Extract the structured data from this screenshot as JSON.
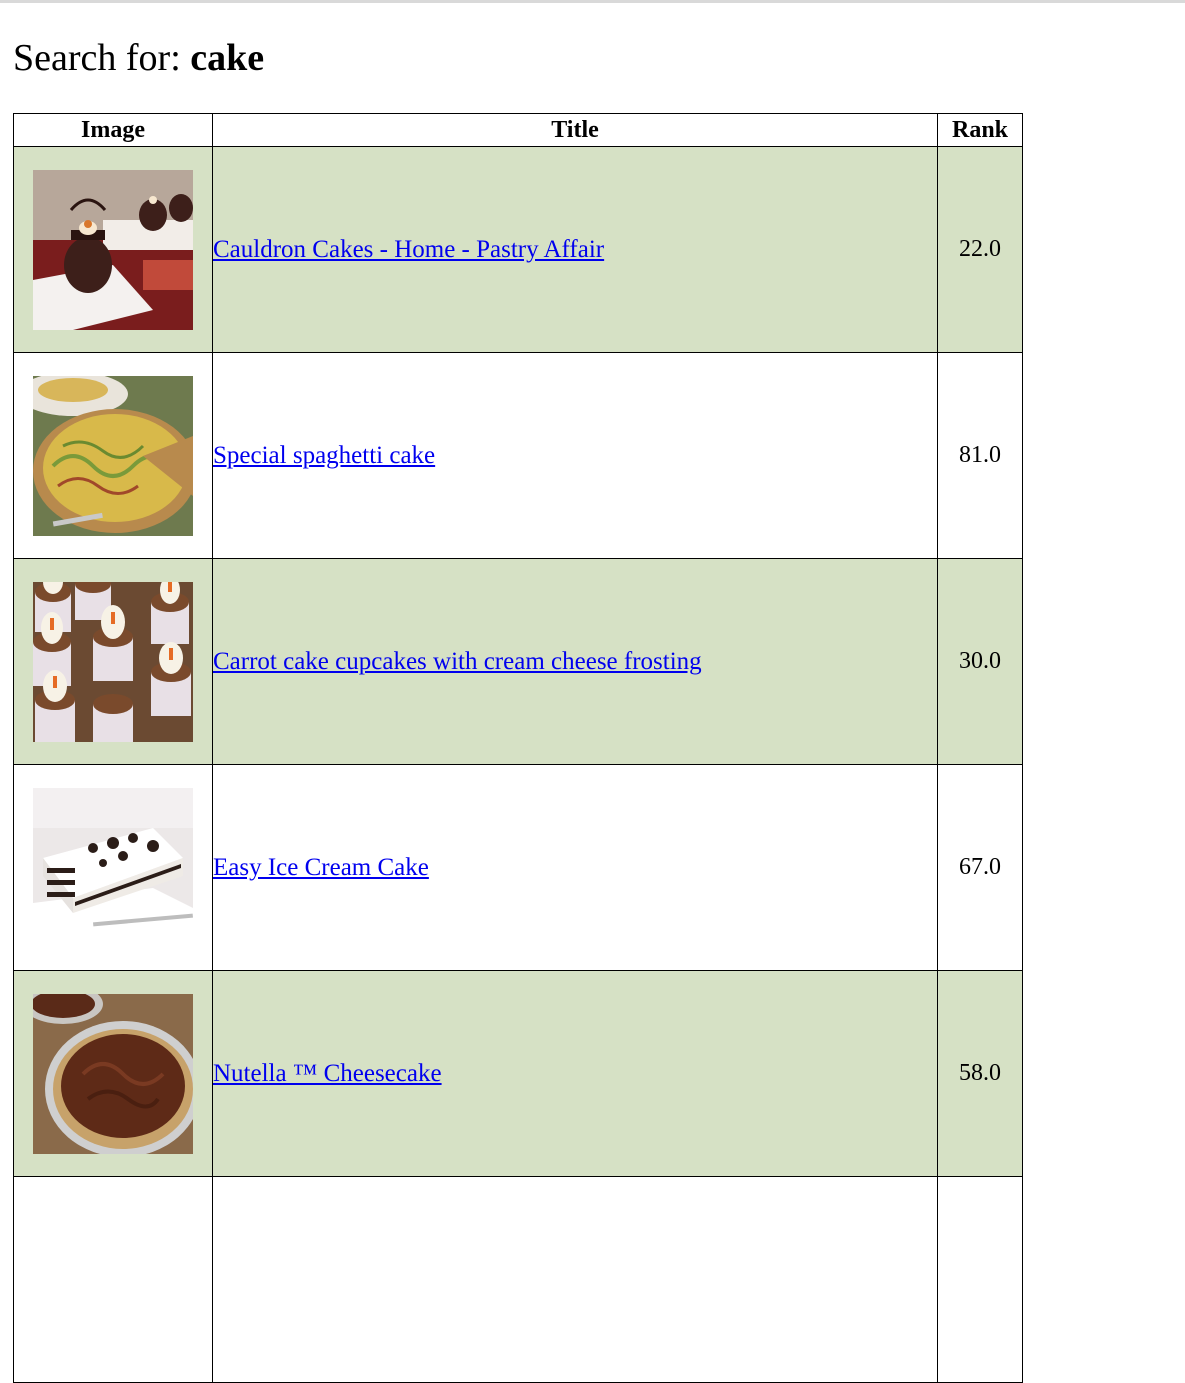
{
  "search": {
    "prefix": "Search for:",
    "query": "cake"
  },
  "table": {
    "headers": [
      "Image",
      "Title",
      "Rank"
    ],
    "rows": [
      {
        "title": "Cauldron Cakes - Home - Pastry Affair",
        "rank": "22.0",
        "image": "cauldron-cakes-photo"
      },
      {
        "title": "Special spaghetti cake",
        "rank": "81.0",
        "image": "spaghetti-cake-photo"
      },
      {
        "title": "Carrot cake cupcakes with cream cheese frosting",
        "rank": "30.0",
        "image": "carrot-cupcakes-photo"
      },
      {
        "title": "Easy Ice Cream Cake",
        "rank": "67.0",
        "image": "ice-cream-cake-photo"
      },
      {
        "title": "Nutella ™  Cheesecake",
        "rank": "58.0",
        "image": "nutella-cheesecake-photo"
      }
    ]
  },
  "colors": {
    "row_alt_bg": "#d6e1c5",
    "link": "#0000ee"
  }
}
